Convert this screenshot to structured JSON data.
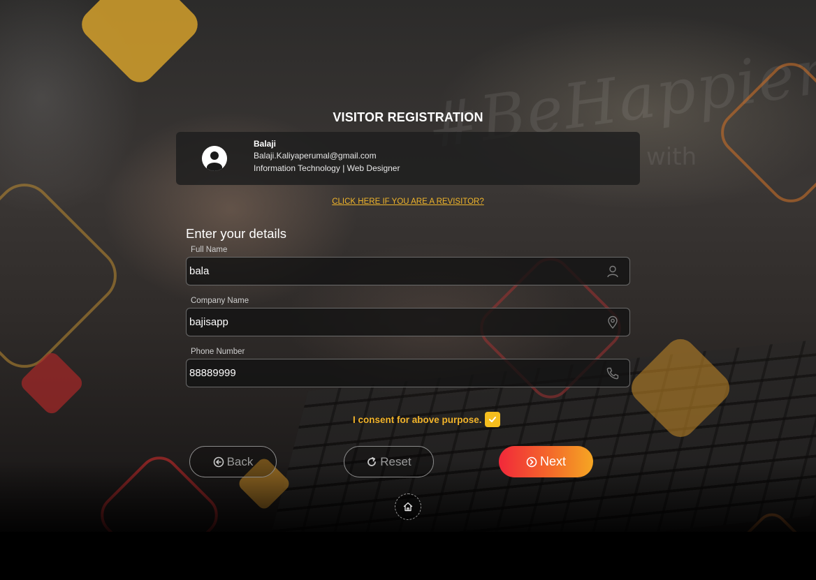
{
  "page": {
    "title": "VISITOR REGISTRATION",
    "watermark_main": "#BeHappier",
    "watermark_sub": "with"
  },
  "host": {
    "name": "Balaji",
    "email": "Balaji.Kaliyaperumal@gmail.com",
    "department": "Information Technology | Web Designer",
    "avatar_icon": "user-avatar-icon"
  },
  "revisit_link": "CLICK HERE IF YOU ARE A REVISITOR?",
  "form": {
    "section_title": "Enter your details",
    "fields": [
      {
        "label": "Full Name",
        "value": "bala",
        "icon": "user-icon"
      },
      {
        "label": "Company Name",
        "value": "bajisapp",
        "icon": "location-pin-icon"
      },
      {
        "label": "Phone Number",
        "value": "88889999",
        "icon": "phone-icon"
      }
    ]
  },
  "consent": {
    "label": "I consent for above purpose.",
    "checked": true
  },
  "buttons": {
    "back": "Back",
    "reset": "Reset",
    "next": "Next",
    "home_icon": "home-icon"
  },
  "colors": {
    "accent_yellow": "#f2b42a",
    "next_gradient_start": "#f1283a",
    "next_gradient_end": "#f5a623",
    "field_border": "#6a6a6a"
  }
}
